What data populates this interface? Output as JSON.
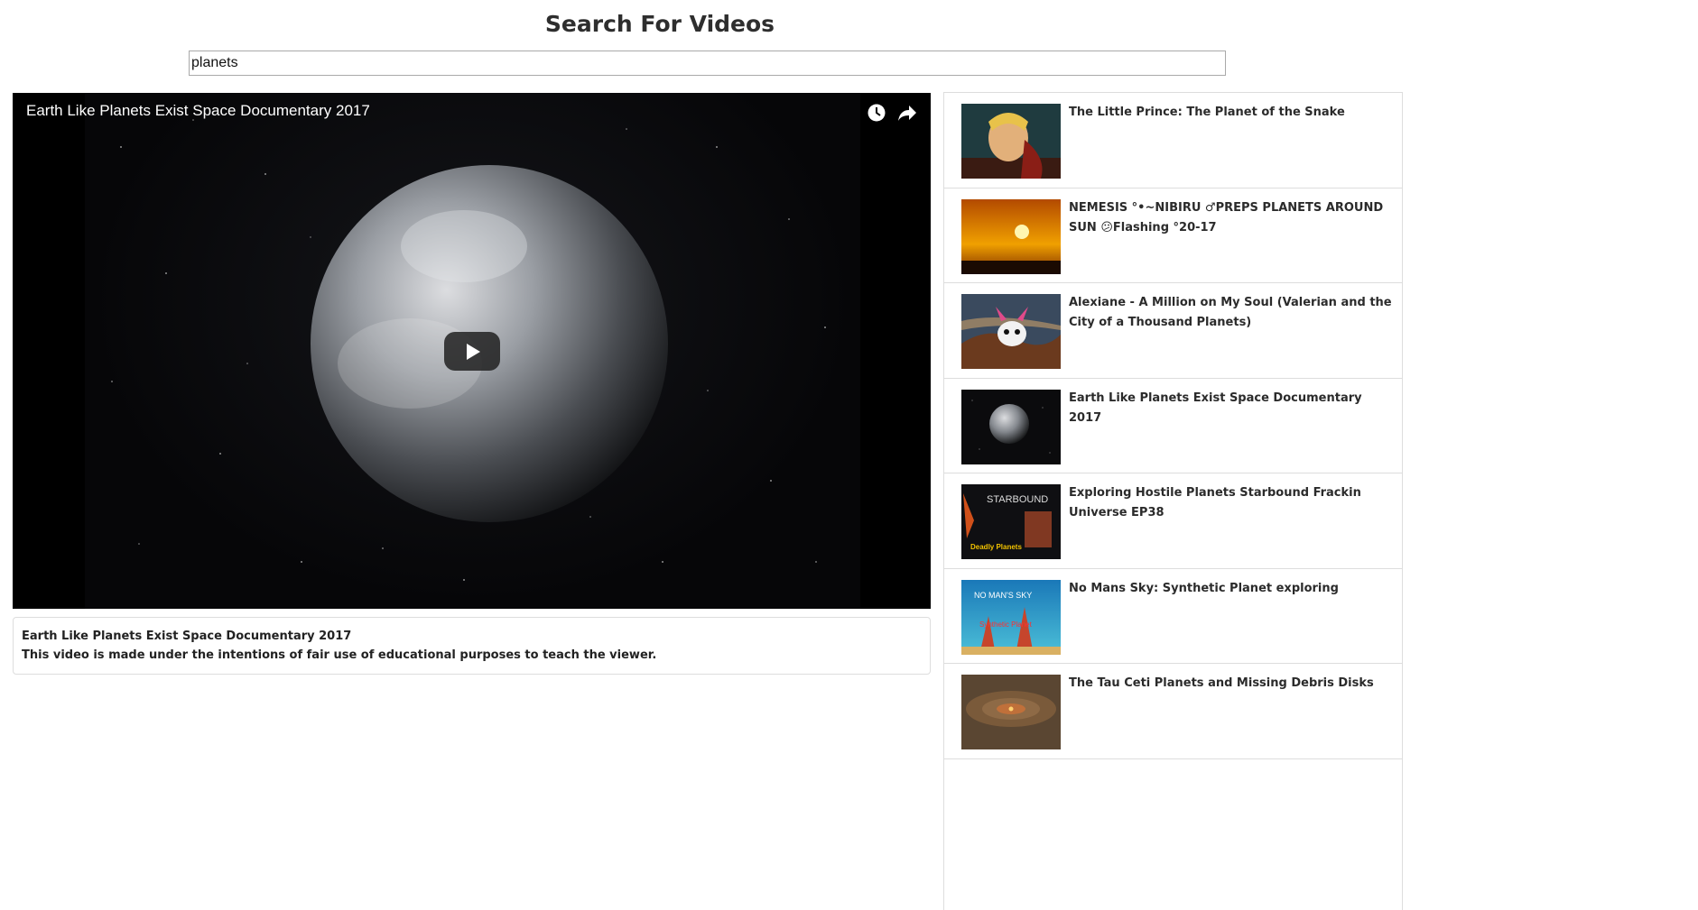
{
  "page": {
    "title": "Search For Videos"
  },
  "search": {
    "value": "planets"
  },
  "player": {
    "title": "Earth Like Planets Exist Space Documentary 2017",
    "watch_later_icon": "clock-icon",
    "share_icon": "share-arrow-icon",
    "play_icon": "play-icon"
  },
  "selected": {
    "title": "Earth Like Planets Exist Space Documentary 2017",
    "description": "This video is made under the intentions of fair use of educational purposes to teach the viewer."
  },
  "results": [
    {
      "title": "The Little Prince: The Planet of the Snake"
    },
    {
      "title": "NEMESIS °•~NIBIRU ♂PREPS PLANETS AROUND SUN 😕Flashing °20-17"
    },
    {
      "title": "Alexiane - A Million on My Soul (Valerian and the City of a Thousand Planets)"
    },
    {
      "title": "Earth Like Planets Exist Space Documentary 2017"
    },
    {
      "title": "Exploring Hostile Planets Starbound Frackin Universe EP38",
      "thumb_text": "STARBOUND",
      "thumb_badge": "Deadly Planets"
    },
    {
      "title": "No Mans Sky: Synthetic Planet exploring",
      "thumb_text": "NO MAN'S SKY",
      "thumb_badge": "Synthetic Planet"
    },
    {
      "title": "The Tau Ceti Planets and Missing Debris Disks"
    }
  ]
}
